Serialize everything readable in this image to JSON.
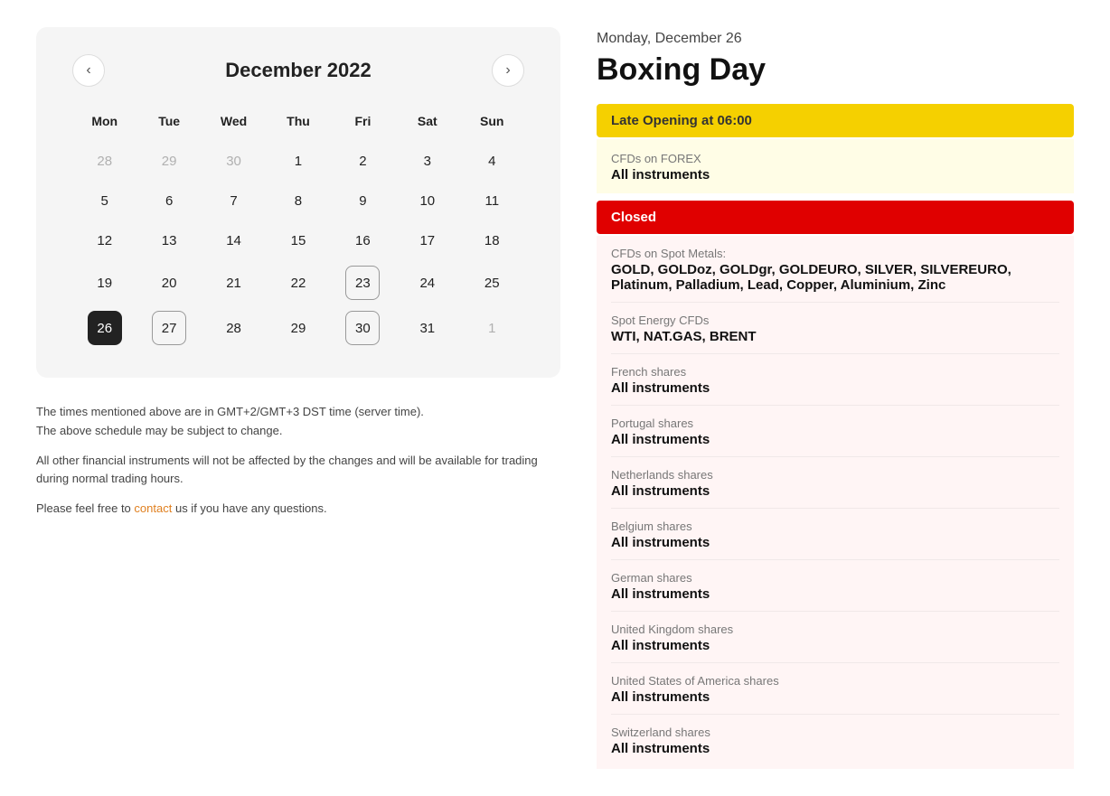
{
  "calendar": {
    "title": "December 2022",
    "weekdays": [
      "Mon",
      "Tue",
      "Wed",
      "Thu",
      "Fri",
      "Sat",
      "Sun"
    ],
    "rows": [
      [
        {
          "day": "28",
          "type": "other-month"
        },
        {
          "day": "29",
          "type": "other-month"
        },
        {
          "day": "30",
          "type": "other-month"
        },
        {
          "day": "1",
          "type": "normal"
        },
        {
          "day": "2",
          "type": "normal"
        },
        {
          "day": "3",
          "type": "normal"
        },
        {
          "day": "4",
          "type": "normal"
        }
      ],
      [
        {
          "day": "5",
          "type": "normal"
        },
        {
          "day": "6",
          "type": "normal"
        },
        {
          "day": "7",
          "type": "normal"
        },
        {
          "day": "8",
          "type": "normal"
        },
        {
          "day": "9",
          "type": "normal"
        },
        {
          "day": "10",
          "type": "normal"
        },
        {
          "day": "11",
          "type": "normal"
        }
      ],
      [
        {
          "day": "12",
          "type": "normal"
        },
        {
          "day": "13",
          "type": "normal"
        },
        {
          "day": "14",
          "type": "normal"
        },
        {
          "day": "15",
          "type": "normal"
        },
        {
          "day": "16",
          "type": "normal"
        },
        {
          "day": "17",
          "type": "normal"
        },
        {
          "day": "18",
          "type": "normal"
        }
      ],
      [
        {
          "day": "19",
          "type": "normal"
        },
        {
          "day": "20",
          "type": "normal"
        },
        {
          "day": "21",
          "type": "normal"
        },
        {
          "day": "22",
          "type": "normal"
        },
        {
          "day": "23",
          "type": "outlined"
        },
        {
          "day": "24",
          "type": "normal"
        },
        {
          "day": "25",
          "type": "normal"
        }
      ],
      [
        {
          "day": "26",
          "type": "selected"
        },
        {
          "day": "27",
          "type": "outlined"
        },
        {
          "day": "28",
          "type": "normal"
        },
        {
          "day": "29",
          "type": "normal"
        },
        {
          "day": "30",
          "type": "outlined"
        },
        {
          "day": "31",
          "type": "normal"
        },
        {
          "day": "1",
          "type": "other-month"
        }
      ]
    ],
    "prev_btn": "‹",
    "next_btn": "›"
  },
  "footnotes": {
    "line1": "The times mentioned above are in GMT+2/GMT+3 DST time (server time).",
    "line2": "The above schedule may be subject to change.",
    "line3": "All other financial instruments will not be affected by the changes and will be available for trading during normal trading hours.",
    "line4": "Please feel free to",
    "contact_text": "contact",
    "line5": "us if you have any questions."
  },
  "event": {
    "date": "Monday, December 26",
    "title": "Boxing Day",
    "late_opening": {
      "banner": "Late Opening at 06:00",
      "items": [
        {
          "label": "CFDs on FOREX",
          "value": "All instruments"
        }
      ]
    },
    "closed": {
      "banner": "Closed",
      "items": [
        {
          "label": "CFDs on Spot Metals:",
          "value": "GOLD, GOLDoz, GOLDgr, GOLDEURO, SILVER, SILVEREURO, Platinum, Palladium, Lead, Copper, Aluminium, Zinc"
        },
        {
          "label": "Spot Energy CFDs",
          "value": "WTI, NAT.GAS, BRENT"
        },
        {
          "label": "French shares",
          "value": "All instruments"
        },
        {
          "label": "Portugal shares",
          "value": "All instruments"
        },
        {
          "label": "Netherlands shares",
          "value": "All instruments"
        },
        {
          "label": "Belgium shares",
          "value": "All instruments"
        },
        {
          "label": "German shares",
          "value": "All instruments"
        },
        {
          "label": "United Kingdom shares",
          "value": "All instruments"
        },
        {
          "label": "United States of America shares",
          "value": "All instruments"
        },
        {
          "label": "Switzerland shares",
          "value": "All instruments"
        }
      ]
    }
  }
}
